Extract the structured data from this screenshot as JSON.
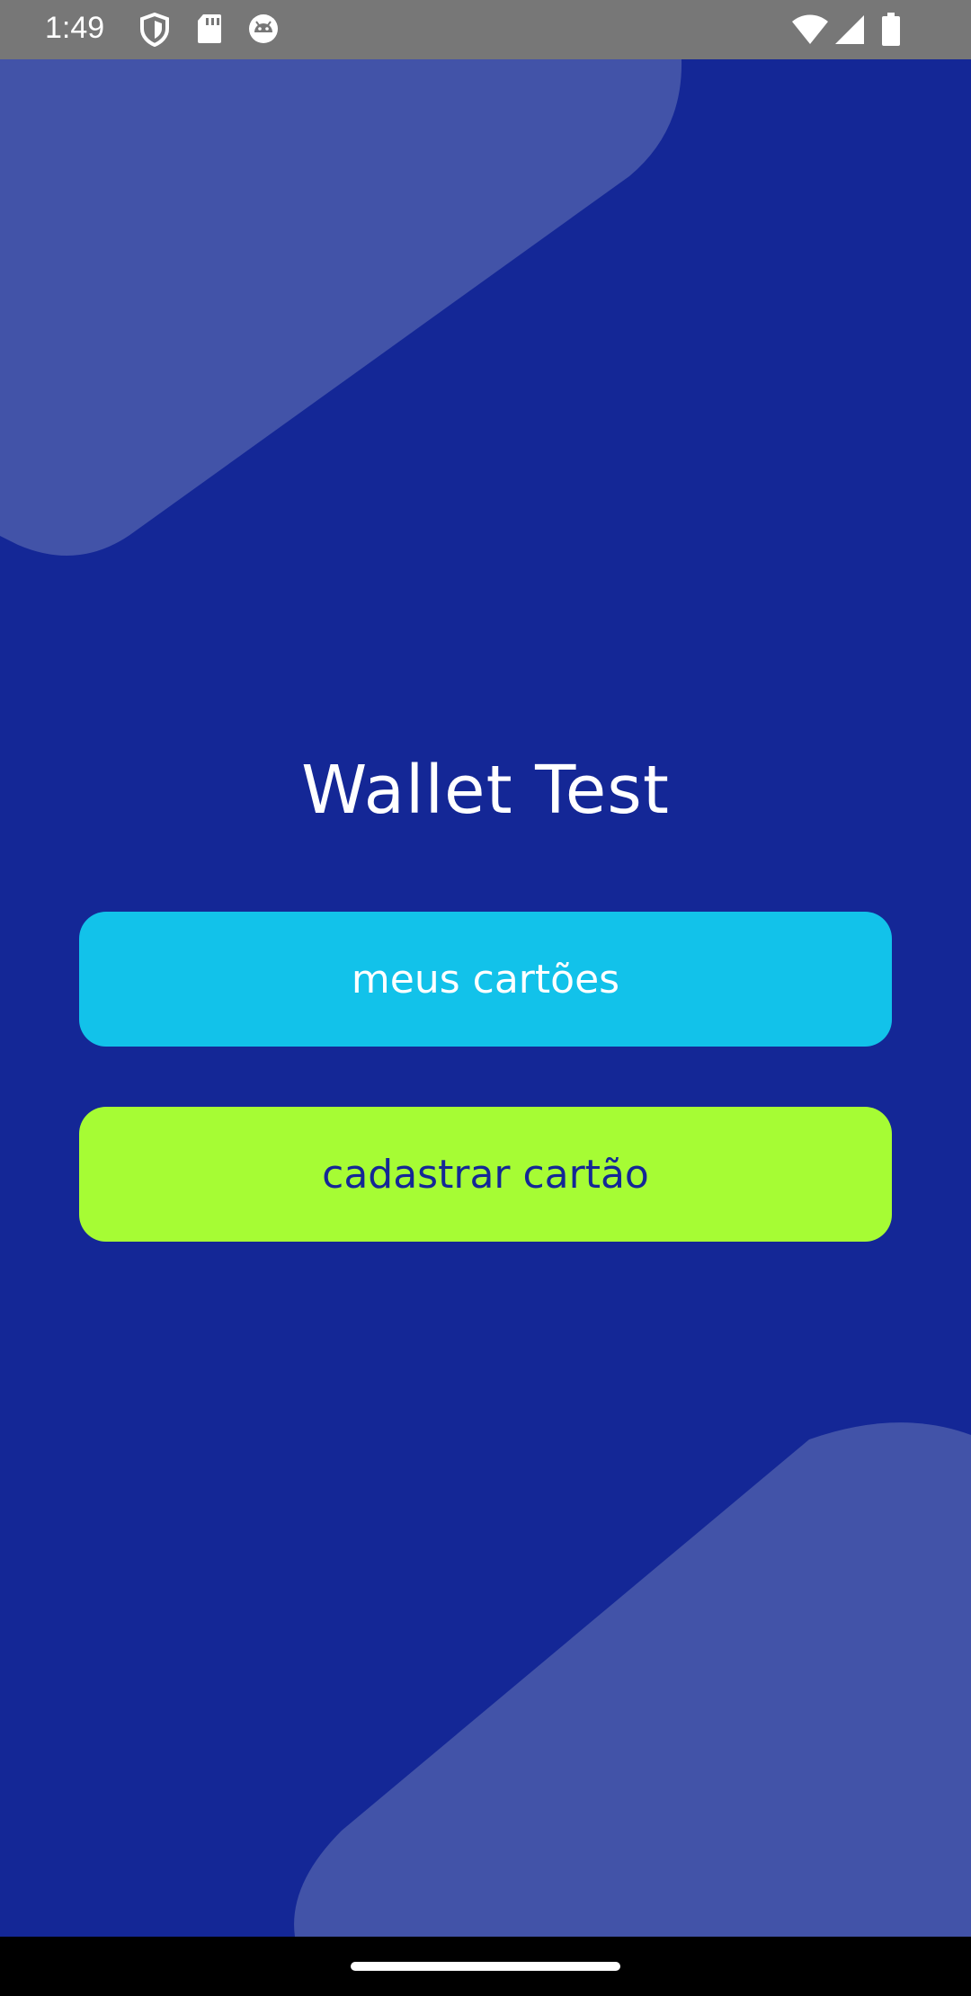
{
  "status_bar": {
    "time": "1:49",
    "left_icons": [
      "shield-icon",
      "sd-card-icon",
      "android-debug-icon"
    ],
    "right_icons": [
      "wifi-icon",
      "cell-signal-icon",
      "battery-icon"
    ]
  },
  "app": {
    "title": "Wallet Test",
    "buttons": {
      "my_cards": "meus cartões",
      "register_card": "cadastrar cartão"
    }
  },
  "colors": {
    "background": "#142796",
    "decor_shape": "#4253a8",
    "primary_button": "#12c2ea",
    "primary_button_text": "#ffffff",
    "secondary_button": "#a6fc34",
    "secondary_button_text": "#142796",
    "status_bar": "#777777",
    "nav_bar": "#000000"
  }
}
